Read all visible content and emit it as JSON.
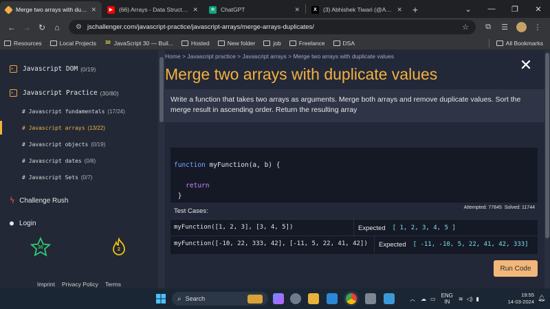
{
  "browser": {
    "tabs": [
      {
        "title": "Merge two arrays with duplicate values",
        "favicon_color": "#f4b13e",
        "active": true
      },
      {
        "title": "(66) Arrays - Data Structures and Algorithms",
        "favicon_color": "#ff0000",
        "active": false
      },
      {
        "title": "ChatGPT",
        "favicon_color": "#10a37f",
        "active": false
      },
      {
        "title": "(3) Abhishek Tiwari (@Abhishek)",
        "favicon_color": "#000000",
        "active": false
      }
    ],
    "new_tab": "+",
    "url": "jschallenger.com/javascript-practice/javascript-arrays/merge-arrays-duplicates/",
    "bookmarks": [
      {
        "label": "Resources"
      },
      {
        "label": "Local Projects"
      },
      {
        "label": "JavaScript 30 — Buil...",
        "prefix": "30"
      },
      {
        "label": "Hosted"
      },
      {
        "label": "New folder"
      },
      {
        "label": "job"
      },
      {
        "label": "Freelance"
      },
      {
        "label": "DSA"
      }
    ],
    "all_bookmarks": "All Bookmarks"
  },
  "sidebar": {
    "sections": [
      {
        "label": "Javascript DOM",
        "count": "(0/19)"
      },
      {
        "label": "Javascript Practice",
        "count": "(30/80)"
      }
    ],
    "subitems": [
      {
        "label": "# Javascript fundamentals",
        "count": "(17/24)"
      },
      {
        "label": "# Javascript arrays",
        "count": "(13/22)"
      },
      {
        "label": "# Javascript objects",
        "count": "(0/19)"
      },
      {
        "label": "# Javascript dates",
        "count": "(0/8)"
      },
      {
        "label": "# Javascript Sets",
        "count": "(0/7)"
      }
    ],
    "challenge_rush": "Challenge Rush",
    "login": "Login",
    "badges": {
      "star": "30",
      "flame": "2"
    },
    "footer": {
      "imprint": "Imprint",
      "privacy": "Privacy Policy",
      "terms": "Terms"
    }
  },
  "main": {
    "breadcrumb": [
      "Home",
      "Javascript practice",
      "Javascript arrays",
      "Merge two arrays with duplicate values"
    ],
    "breadcrumb_sep": ">",
    "title": "Merge two arrays with duplicate values",
    "description": "Write a function that takes two arrays as arguments. Merge both arrays and remove duplicate values. Sort the merge result in ascending order. Return the resulting array",
    "code": {
      "keyword_function": "function",
      "signature": "myFunction(a, b) {",
      "keyword_return": "return",
      "closing": "}"
    },
    "test_cases_label": "Test Cases:",
    "stats": {
      "attempted": "Attempted: 77845",
      "solved": "Solved: 11744"
    },
    "expected_label": "Expected",
    "test_cases": [
      {
        "call": "myFunction([1, 2, 3], [3, 4, 5])",
        "expected": "[ 1, 2, 3, 4, 5 ]"
      },
      {
        "call": "myFunction([-10, 22, 333, 42], [-11, 5, 22, 41, 42])",
        "expected": "[ -11, -10, 5, 22, 41,  42, 333]"
      }
    ],
    "run_button": "Run Code"
  },
  "taskbar": {
    "search_placeholder": "Search",
    "lang_top": "ENG",
    "lang_bottom": "IN",
    "time": "19:55",
    "date": "14-03-2024"
  }
}
